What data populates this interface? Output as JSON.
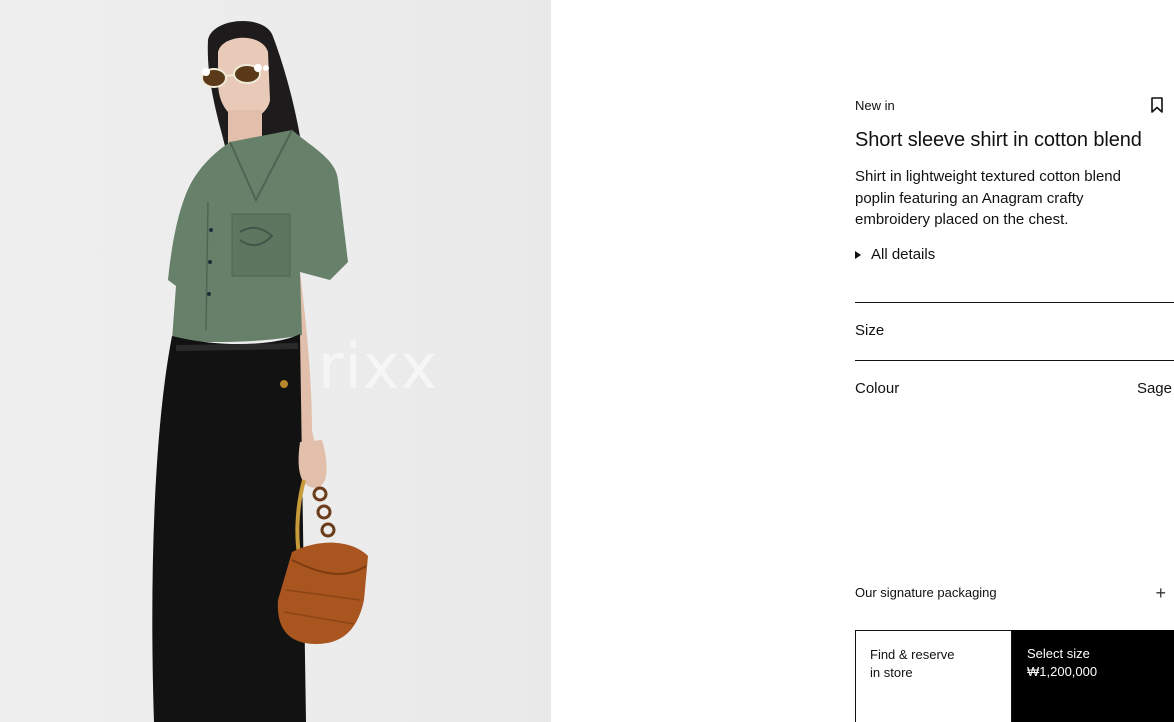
{
  "image": {
    "watermark_text": "rixx"
  },
  "product": {
    "badge": "New in",
    "title": "Short sleeve shirt in cotton blend",
    "description": "Shirt in lightweight textured cotton blend poplin featuring an Anagram crafty embroidery placed on the chest.",
    "details_label": "All details",
    "bookmark_icon": "bookmark-icon"
  },
  "size": {
    "label": "Size"
  },
  "colour": {
    "label": "Colour",
    "value": "Sage"
  },
  "packaging": {
    "label": "Our signature packaging",
    "icon": "plus-icon"
  },
  "actions": {
    "find_line1": "Find & reserve",
    "find_line2": "in store",
    "select_line1": "Select size",
    "price": "₩1,200,000"
  },
  "colors": {
    "background": "#ffffff",
    "image_background": "#ececec",
    "shirt": "#67806a",
    "trousers": "#121212",
    "bag": "#a9551f",
    "cta": "#000000"
  }
}
